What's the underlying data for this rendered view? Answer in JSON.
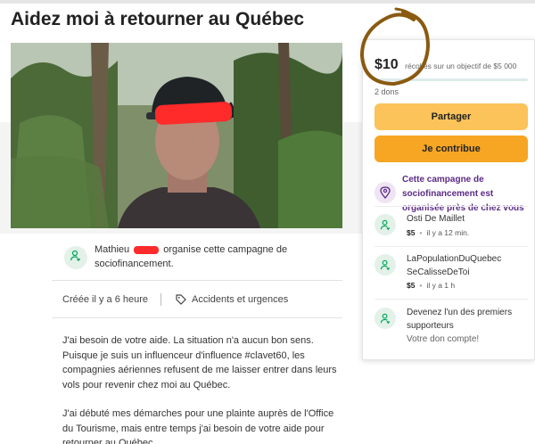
{
  "page": {
    "title": "Aidez moi à retourner au Québec"
  },
  "organizer": {
    "name": "Mathieu",
    "action_text": "organise cette campagne de sociofinancement.",
    "avatar_icon": "user-heart-icon"
  },
  "meta": {
    "created": "Créée il y a 6 heure",
    "category": "Accidents et urgences",
    "category_icon": "tag-icon"
  },
  "story": {
    "paragraphs": [
      "J'ai besoin de votre aide. La situation n'a aucun bon sens. Puisque je suis un influenceur d'influence #clavet60, les compagnies aériennes refusent de me laisser entrer dans leurs vols pour revenir chez moi au Québec.",
      "J'ai débuté mes démarches pour une plainte auprès de l'Office du Tourisme, mais entre temps j'ai besoin de votre aide pour retourner au Québec."
    ]
  },
  "sidebar": {
    "raised_amount": "$10",
    "goal_text": "récoltés sur un objectif de $5 000",
    "progress_fraction": 0.002,
    "donation_count": "2 dons",
    "share_label": "Partager",
    "donate_label": "Je contribue",
    "location_notice": "Cette campagne de sociofinancement est organisée près de chez vous",
    "donations": [
      {
        "name": "Osti De Maillet",
        "amount": "$5",
        "time": "il y a 12 min."
      },
      {
        "name": "LaPopulationDuQuebec SeCalisseDeToi",
        "amount": "$5",
        "time": "il y a 1 h"
      }
    ],
    "first_supporters": {
      "title": "Devenez l'un des premiers supporteurs",
      "subtitle": "Votre don compte!"
    }
  },
  "colors": {
    "accent_green": "#02a95c",
    "share_button": "#fbc35a",
    "donate_button": "#f6a623",
    "location_text": "#5b2a86",
    "redaction": "#ff2a2a",
    "annotation_circle": "#8a5a10"
  }
}
